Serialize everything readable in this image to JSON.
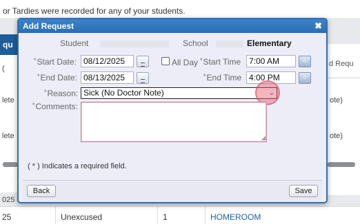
{
  "background": {
    "notice_text": "or Tardies were recorded for any of your students.",
    "header_left": "qu",
    "left_col_texts": [
      "(",
      "lete",
      "lete"
    ],
    "right_header": "d Requ",
    "right_col_texts": [
      "ote)",
      "ote)"
    ],
    "row_number_above": "025",
    "row": {
      "num": "25",
      "type": "Unexcused",
      "period": "1",
      "course": "HOMEROOM"
    }
  },
  "dialog": {
    "title": "Add Request",
    "student_label": "Student",
    "school_label": "School",
    "school_value": "Elementary",
    "start_date_label": "Start Date:",
    "start_date": "08/12/2025",
    "end_date_label": "End Date:",
    "end_date": "08/13/2025",
    "all_day_label": "All Day",
    "start_time_label": "Start Time",
    "start_time": "7:00 AM",
    "end_time_label": "End Time",
    "end_time": "4:00 PM",
    "reason_label": "Reason:",
    "reason_selected": "Sick (No Doctor Note)",
    "comments_label": "Comments:",
    "required_note": "( * ) Indicates a required field.",
    "back_label": "Back",
    "save_label": "Save",
    "required_marker": "*"
  },
  "icons": {
    "close": "close-icon",
    "calendar": "calendar-icon",
    "clock": "clock-icon",
    "dropdown": "chevron-down-icon"
  },
  "colors": {
    "titlebar": "#2f6fb5",
    "dialog_bg": "#ededf8",
    "link": "#1f5fa8",
    "highlight": "#e45a6e"
  }
}
